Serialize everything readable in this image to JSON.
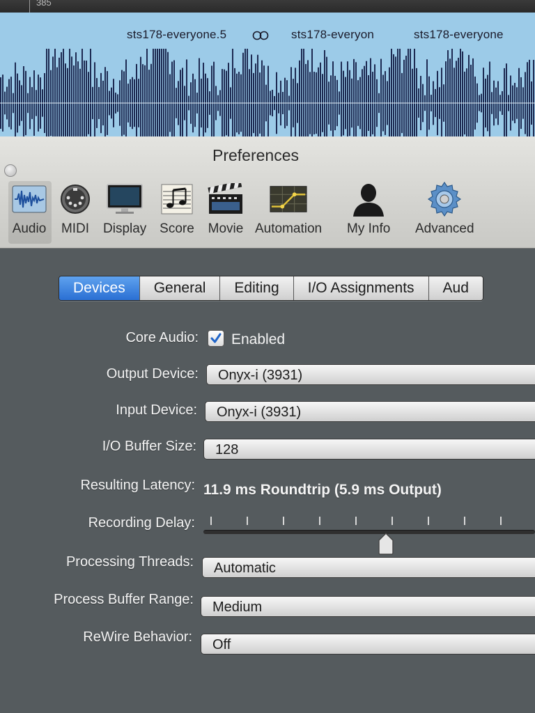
{
  "arrange": {
    "ruler_number": "385",
    "regions": [
      {
        "name": "sts178-everyone.5",
        "loop_icon": "loop-icon"
      },
      {
        "name": "sts178-everyon"
      },
      {
        "name": "sts178-everyone"
      }
    ]
  },
  "preferences": {
    "title": "Preferences",
    "toolbar": [
      {
        "label": "Audio",
        "icon": "audio-waveform-icon",
        "selected": true
      },
      {
        "label": "MIDI",
        "icon": "midi-connector-icon"
      },
      {
        "label": "Display",
        "icon": "monitor-icon"
      },
      {
        "label": "Score",
        "icon": "score-notes-icon"
      },
      {
        "label": "Movie",
        "icon": "clapperboard-icon"
      },
      {
        "label": "Automation",
        "icon": "automation-curve-icon"
      },
      {
        "label": "My Info",
        "icon": "user-silhouette-icon"
      },
      {
        "label": "Advanced",
        "icon": "gear-icon"
      }
    ],
    "tabs": [
      {
        "label": "Devices",
        "selected": true
      },
      {
        "label": "General"
      },
      {
        "label": "Editing"
      },
      {
        "label": "I/O Assignments"
      },
      {
        "label": "Aud"
      }
    ],
    "devices": {
      "core_audio_label": "Core Audio:",
      "core_audio_enabled_label": "Enabled",
      "core_audio_checked": true,
      "output_device_label": "Output Device:",
      "output_device_value": "Onyx-i (3931)",
      "input_device_label": "Input Device:",
      "input_device_value": "Onyx-i (3931)",
      "buffer_size_label": "I/O Buffer Size:",
      "buffer_size_value": "128",
      "latency_label": "Resulting Latency:",
      "latency_value": "11.9 ms Roundtrip (5.9 ms Output)",
      "recording_delay_label": "Recording Delay:",
      "recording_delay_position": 0.55,
      "processing_threads_label": "Processing Threads:",
      "processing_threads_value": "Automatic",
      "process_buffer_range_label": "Process Buffer Range:",
      "process_buffer_range_value": "Medium",
      "rewire_behavior_label": "ReWire Behavior:",
      "rewire_behavior_value": "Off"
    }
  },
  "colors": {
    "selected_tab": "#2a6fd3",
    "waveform_bg": "#9ccbe8",
    "waveform_fg": "#1d2a52",
    "panel_bg": "#555b5e"
  }
}
